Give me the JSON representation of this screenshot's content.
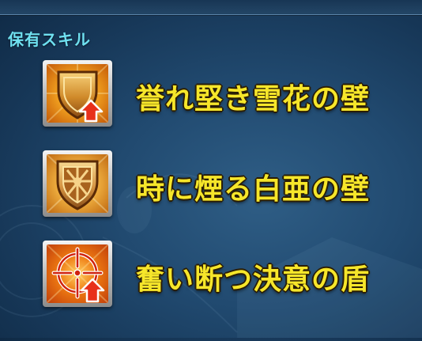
{
  "section": {
    "title": "保有スキル"
  },
  "skills": [
    {
      "name": "誉れ堅き雪花の壁",
      "icon": "shield-up-icon"
    },
    {
      "name": "時に煙る白亜の壁",
      "icon": "shield-cross-icon"
    },
    {
      "name": "奮い断つ決意の盾",
      "icon": "target-up-icon"
    }
  ],
  "colors": {
    "header": "#6fe0f0",
    "skill_name": "#f6e62a",
    "icon_bg_orange": "#e07a10",
    "arrow_red": "#e02a10"
  }
}
